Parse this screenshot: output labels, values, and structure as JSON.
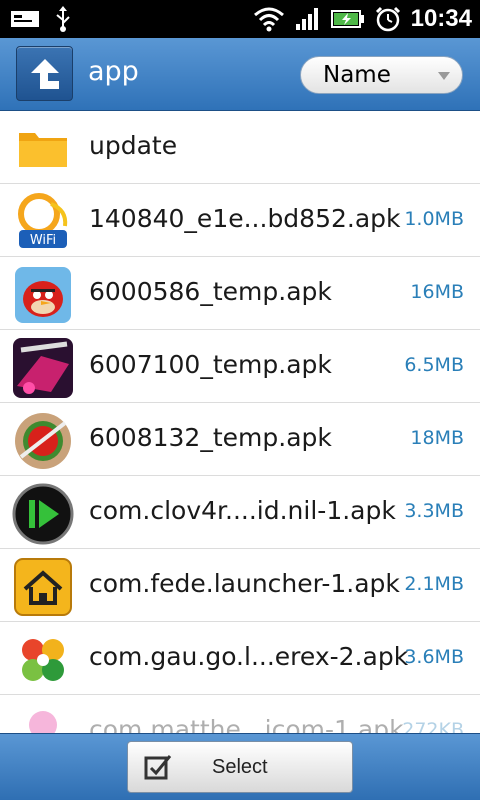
{
  "status_bar": {
    "time": "10:34",
    "icons": [
      "message-icon",
      "usb-icon",
      "wifi-icon",
      "signal-icon",
      "battery-charging-icon",
      "alarm-icon"
    ]
  },
  "header": {
    "title": "app",
    "sort_value": "Name"
  },
  "files": [
    {
      "name": "update",
      "size": "",
      "icon": "folder-icon"
    },
    {
      "name": "140840_e1e...bd852.apk",
      "size": "1.0MB",
      "icon": "wifi-app-icon"
    },
    {
      "name": "6000586_temp.apk",
      "size": "16MB",
      "icon": "angry-birds-icon"
    },
    {
      "name": "6007100_temp.apk",
      "size": "6.5MB",
      "icon": "racing-game-icon"
    },
    {
      "name": "6008132_temp.apk",
      "size": "18MB",
      "icon": "fruit-ninja-icon"
    },
    {
      "name": "com.clov4r....id.nil-1.apk",
      "size": "3.3MB",
      "icon": "video-player-icon"
    },
    {
      "name": "com.fede.launcher-1.apk",
      "size": "2.1MB",
      "icon": "launcher-home-icon"
    },
    {
      "name": "com.gau.go.l...erex-2.apk",
      "size": "3.6MB",
      "icon": "go-launcher-clover-icon"
    },
    {
      "name": "com.matthe...icom-1.apk",
      "size": "272KB",
      "icon": "pink-ball-icon"
    }
  ],
  "bottom_bar": {
    "select_label": "Select"
  },
  "colors": {
    "header_blue": "#3a7dc2",
    "size_text": "#2a7fb8",
    "folder": "#f7b21e"
  }
}
